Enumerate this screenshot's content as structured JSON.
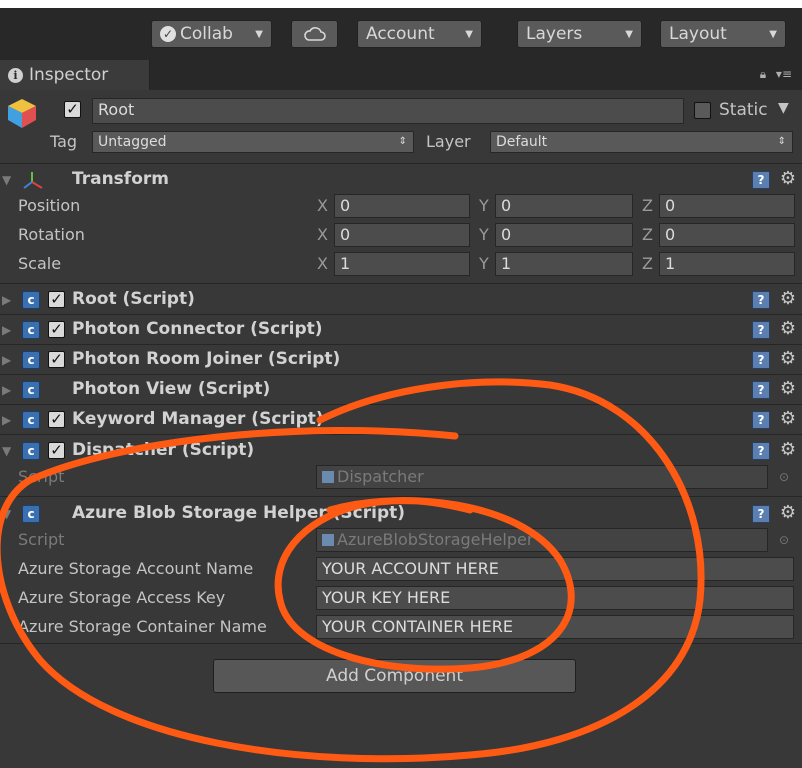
{
  "toolbar": {
    "collab": "Collab",
    "account": "Account",
    "layers": "Layers",
    "layout": "Layout"
  },
  "tab": {
    "label": "Inspector"
  },
  "object": {
    "name": "Root",
    "static_label": "Static",
    "tag_label": "Tag",
    "tag_value": "Untagged",
    "layer_label": "Layer",
    "layer_value": "Default"
  },
  "transform": {
    "title": "Transform",
    "rows": [
      {
        "label": "Position",
        "x": "0",
        "y": "0",
        "z": "0"
      },
      {
        "label": "Rotation",
        "x": "0",
        "y": "0",
        "z": "0"
      },
      {
        "label": "Scale",
        "x": "1",
        "y": "1",
        "z": "1"
      }
    ],
    "axis_x": "X",
    "axis_y": "Y",
    "axis_z": "Z"
  },
  "components": [
    {
      "title": "Root (Script)"
    },
    {
      "title": "Photon Connector (Script)"
    },
    {
      "title": "Photon Room Joiner (Script)"
    },
    {
      "title": "Photon View (Script)"
    },
    {
      "title": "Keyword Manager (Script)"
    },
    {
      "title": "Dispatcher (Script)"
    },
    {
      "title": "Azure Blob Storage Helper (Script)"
    }
  ],
  "dispatcher": {
    "script_label": "Script",
    "script_value": "Dispatcher"
  },
  "azure": {
    "script_label": "Script",
    "script_value": "AzureBlobStorageHelper",
    "account_label": "Azure Storage Account Name",
    "account_value": "YOUR ACCOUNT HERE",
    "key_label": "Azure Storage Access Key",
    "key_value": "YOUR KEY HERE",
    "container_label": "Azure Storage Container Name",
    "container_value": "YOUR CONTAINER HERE"
  },
  "add_component": "Add Component",
  "colors": {
    "annotation": "#ff5a14",
    "background": "#383838"
  }
}
